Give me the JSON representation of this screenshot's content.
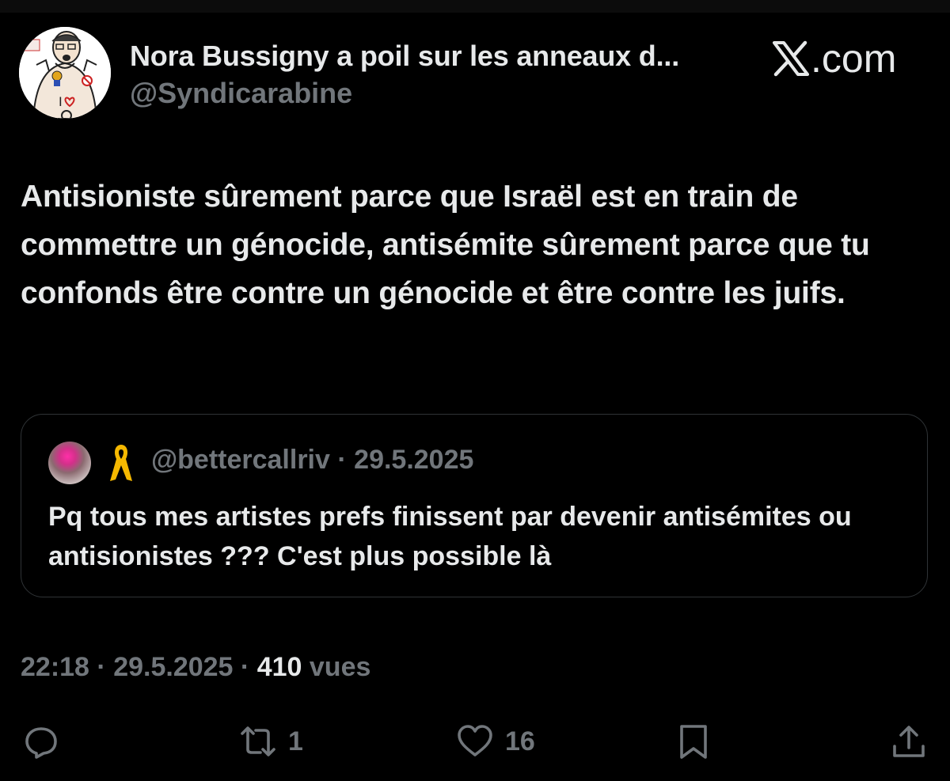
{
  "author": {
    "display_name": "Nora Bussigny a poil sur les anneaux d...",
    "handle": "@Syndicarabine",
    "avatar": "cartoon-avatar-icon"
  },
  "brand": {
    "text": ".com",
    "icon": "x-logo-icon"
  },
  "post": {
    "text": "Antisioniste sûrement parce que Israël est en train de commettre un génocide, antisémite sûrement parce que tu confonds être contre un génocide et être contre les juifs."
  },
  "quoted_post": {
    "handle": "@bettercallriv",
    "separator": "·",
    "date": "29.5.2025",
    "ribbon": "yellow-ribbon-icon",
    "text": "Pq tous mes artistes prefs finissent par devenir antisémites ou antisionistes ??? C'est plus possible là"
  },
  "stats": {
    "time": "22:18",
    "separator": "·",
    "date": "29.5.2025",
    "views_count": "410",
    "views_label": "vues"
  },
  "actions": {
    "reply": {
      "icon": "reply-icon",
      "count": ""
    },
    "repost": {
      "icon": "repost-icon",
      "count": "1"
    },
    "like": {
      "icon": "heart-icon",
      "count": "16"
    },
    "bookmark": {
      "icon": "bookmark-icon",
      "count": ""
    },
    "share": {
      "icon": "share-icon",
      "count": ""
    }
  },
  "colors": {
    "background": "#000000",
    "primary_text": "#e7e9ea",
    "secondary_text": "#71767b",
    "border": "#2f3336"
  }
}
